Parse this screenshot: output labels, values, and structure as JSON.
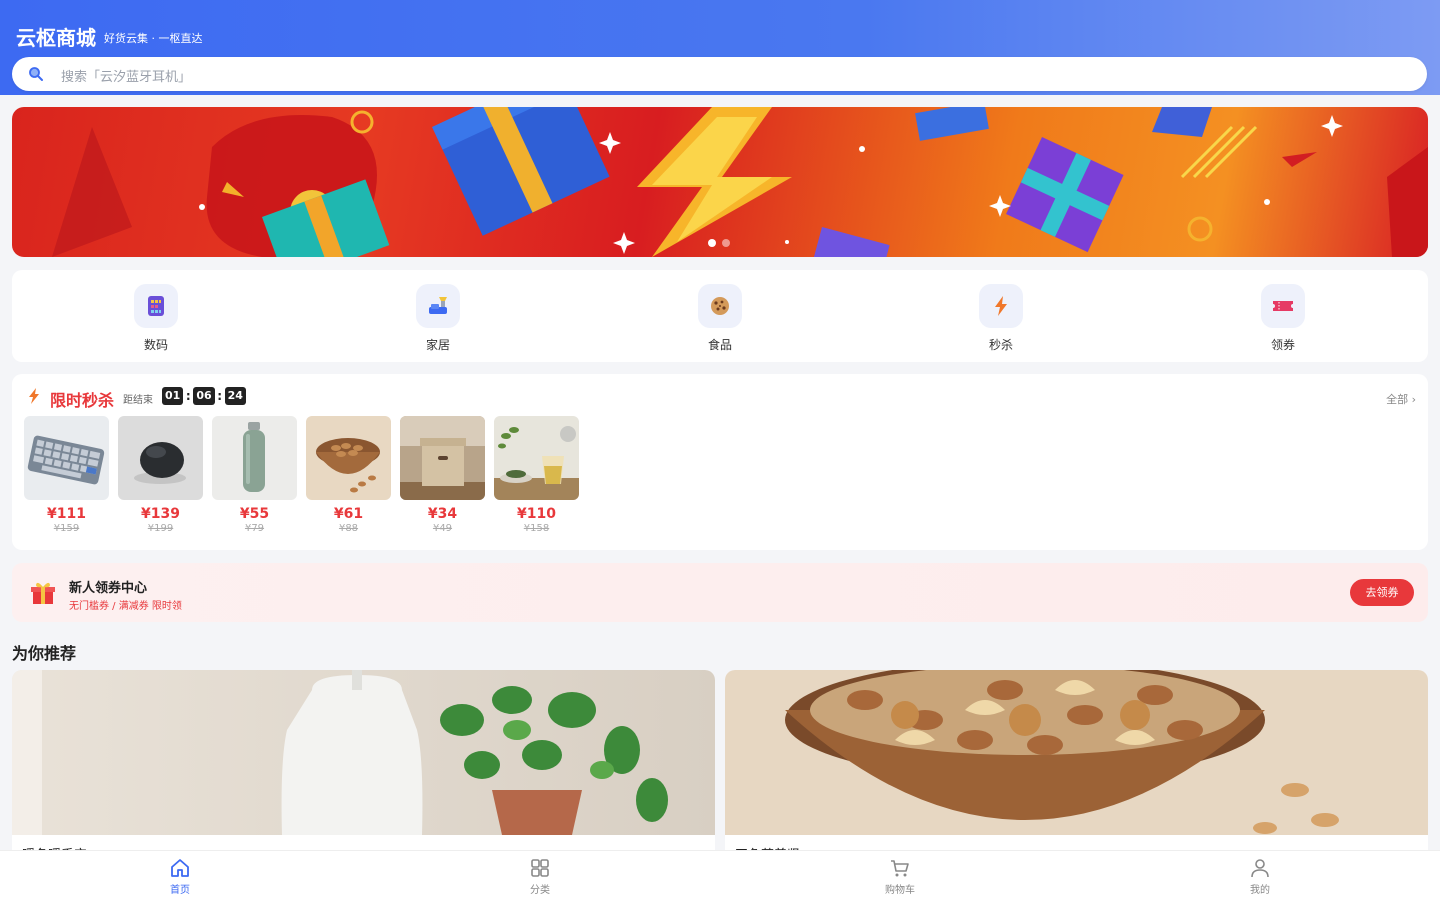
{
  "header": {
    "brand": "云枢商城",
    "slogan": "好货云集 · 一枢直达"
  },
  "search": {
    "placeholder": "搜索「云汐蓝牙耳机」"
  },
  "banner": {
    "slides": 2,
    "active_slide": 1
  },
  "categories": [
    {
      "label": "数码",
      "icon": "tablet-icon"
    },
    {
      "label": "家居",
      "icon": "sofa-icon"
    },
    {
      "label": "食品",
      "icon": "cookie-icon"
    },
    {
      "label": "秒杀",
      "icon": "lightning-icon"
    },
    {
      "label": "领券",
      "icon": "ticket-icon"
    }
  ],
  "flash_sale": {
    "title": "限时秒杀",
    "ends_label": "距结束",
    "timer": {
      "h": "01",
      "m": "06",
      "s": "24"
    },
    "more_label": "全部 ›",
    "products": [
      {
        "price": "¥111",
        "original": "¥159",
        "image": "keyboard"
      },
      {
        "price": "¥139",
        "original": "¥199",
        "image": "mouse"
      },
      {
        "price": "¥55",
        "original": "¥79",
        "image": "water-bottle"
      },
      {
        "price": "¥61",
        "original": "¥88",
        "image": "nuts-bowl"
      },
      {
        "price": "¥34",
        "original": "¥49",
        "image": "storage-box"
      },
      {
        "price": "¥110",
        "original": "¥158",
        "image": "tea-cup"
      }
    ]
  },
  "coupon": {
    "title": "新人领券中心",
    "subtitle": "无门槛券 / 满减券 限时领",
    "button": "去领券"
  },
  "recommend": {
    "title": "为你推荐",
    "items": [
      {
        "name": "暖冬暖手宝",
        "image": "humidifier-plant"
      },
      {
        "name": "四色营养坚",
        "image": "nuts-bowl"
      }
    ]
  },
  "tabbar": [
    {
      "label": "首页",
      "icon": "home-icon",
      "active": true
    },
    {
      "label": "分类",
      "icon": "grid-icon",
      "active": false
    },
    {
      "label": "购物车",
      "icon": "cart-icon",
      "active": false
    },
    {
      "label": "我的",
      "icon": "user-icon",
      "active": false
    }
  ],
  "colors": {
    "primary": "#3d6af2",
    "accent_red": "#e8383b"
  }
}
